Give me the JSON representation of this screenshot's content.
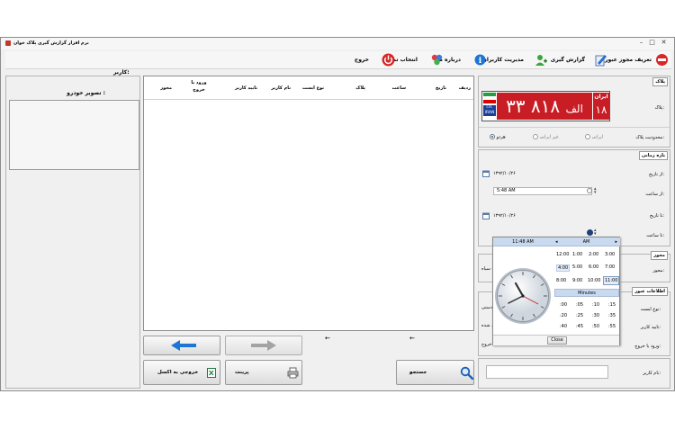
{
  "window": {
    "title": "نرم افزار گزارش گیری پلاک خوان",
    "controls": [
      "–",
      "□",
      "✕"
    ]
  },
  "menu": {
    "items": [
      {
        "label": "تعریف مجوز عبور",
        "icon": "no-entry-icon"
      },
      {
        "label": "گزارش گیری",
        "icon": "report-icon"
      },
      {
        "label": "مدیریت کاربران",
        "icon": "users-icon"
      },
      {
        "label": "درباره ما",
        "icon": "info-icon"
      },
      {
        "label": "انتخاب تم",
        "icon": "theme-icon"
      },
      {
        "label": "خروج",
        "icon": "power-icon"
      }
    ],
    "user_label": "کاربر:"
  },
  "plate_panel": {
    "header": "پلاک",
    "field_label": "پلاک:",
    "plate": {
      "d1": "۱۸",
      "letter": "الف",
      "d2": "۸۱۸",
      "d3": "۳۳",
      "country": "ایران",
      "iso1": "I.R.",
      "iso2": "IRAN",
      "region": "۱۸"
    },
    "scope_label": "محدودیت پلاک:",
    "options": [
      "هردو",
      "غیر ایرانی",
      "ایرانی"
    ],
    "selected": "هردو"
  },
  "time_panel": {
    "header": "بازه زمانی",
    "from_date_label": "از تاریخ:",
    "from_date": "۱۳۹۲/۱۰/۲۶",
    "from_time_label": "از ساعت:",
    "from_time": "5:48 AM",
    "to_date_label": "تا تاریخ:",
    "to_date": "۱۳۹۲/۱۰/۲۶",
    "to_time_label": "تا ساعت:"
  },
  "permit_panel": {
    "header": "مجوز",
    "field_label": "مجوز:",
    "clipped_text": "ت سیاه"
  },
  "traffic_panel": {
    "header": "اطلاعات عبور",
    "type_label": "نوع ایست:",
    "type_clip": "ه دستی",
    "confirm_label": "تایید کاربر:",
    "confirm_clip": "ئید شده",
    "io_label": "ورود یا خروج:",
    "io_clip": "خروج"
  },
  "username": {
    "label": "نام کاربر:"
  },
  "clock_picker": {
    "time": "11:48 AM",
    "ampm": "AM",
    "hours": [
      "12:00",
      "1:00",
      "2:00",
      "3:00",
      "4:00",
      "5:00",
      "6:00",
      "7:00",
      "8:00",
      "9:00",
      "10:00",
      "11:00"
    ],
    "minutes_header": "Minutes",
    "minutes": [
      ":00",
      ":05",
      ":10",
      ":15",
      ":20",
      ":25",
      ":30",
      ":35",
      ":40",
      ":45",
      ":50",
      ":55"
    ],
    "close_label": "Close"
  },
  "table": {
    "columns": [
      "ردیف",
      "تاریخ",
      "ساعت",
      "پلاک",
      "نوع ایست",
      "نام کاربر",
      "تایید کاربر",
      "ورود یا خروج",
      "مجوز"
    ],
    "arrow_left": "←",
    "arrow_left2": "←"
  },
  "bottom_buttons": {
    "search": "جستجو",
    "print": "پرینت",
    "excel": "خروجی به اکسل"
  },
  "car_image": {
    "label": "تصویر خودرو :"
  },
  "colors": {
    "plate_red": "#c81d25",
    "accent_blue": "#1d75d6",
    "clock_header": "#c9daf0"
  }
}
